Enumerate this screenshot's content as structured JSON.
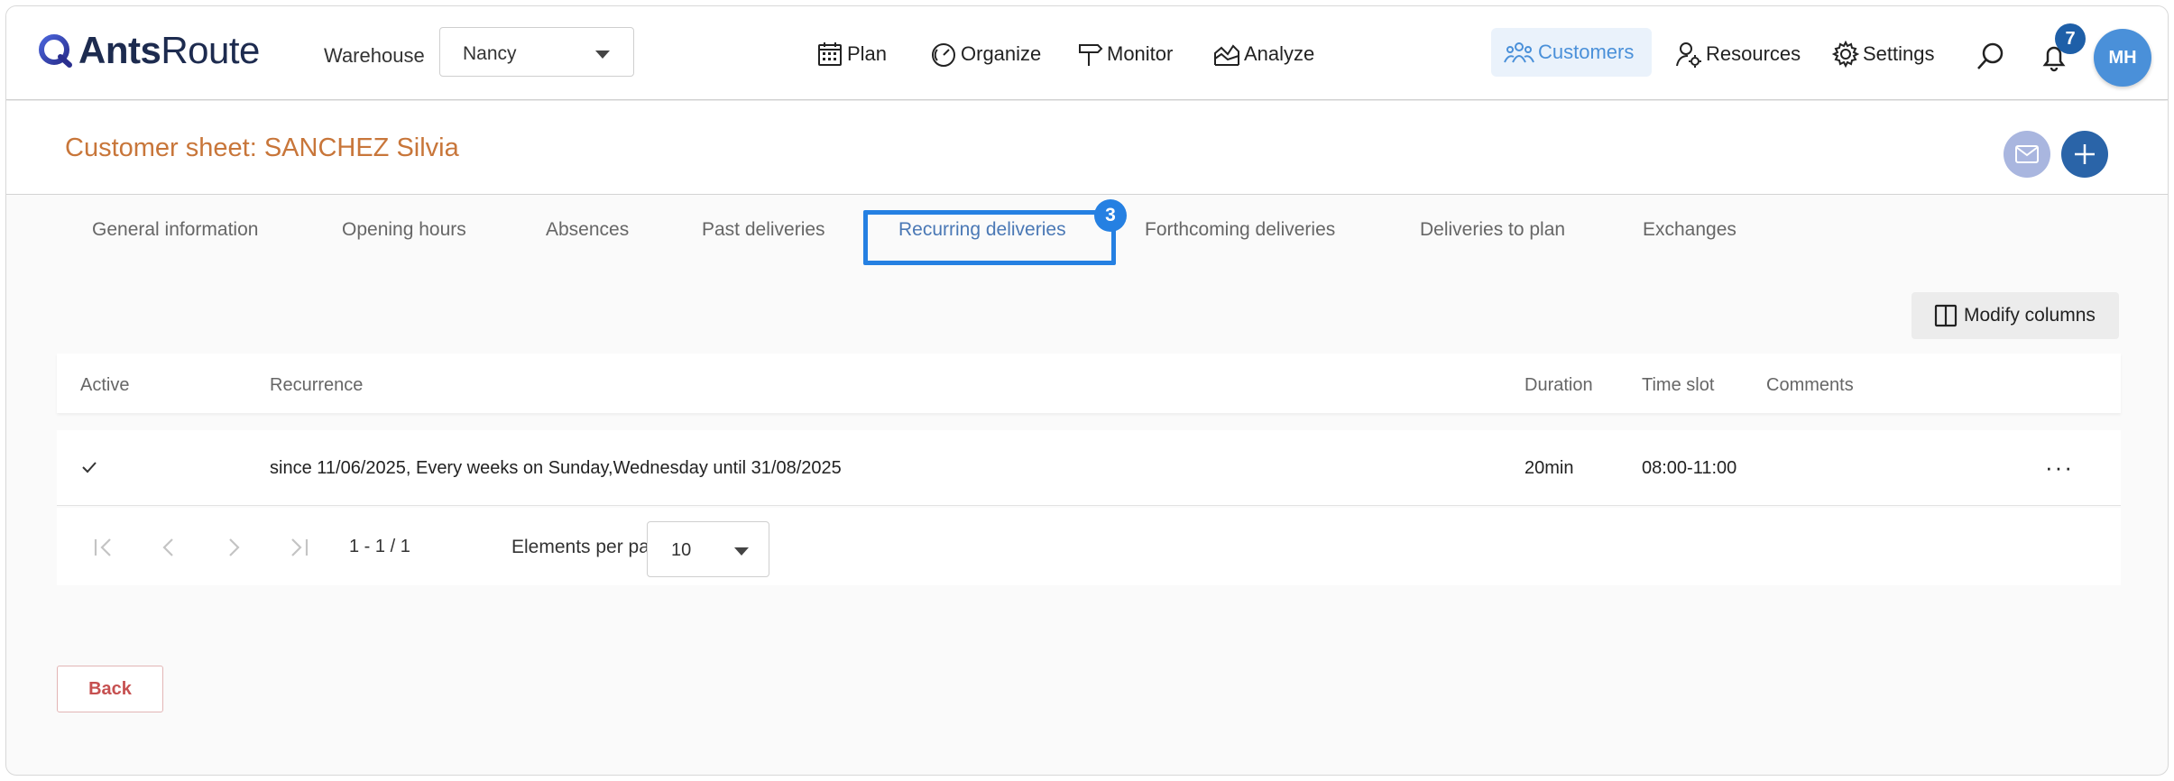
{
  "app": {
    "logo_bold": "Ants",
    "logo_light": "Route",
    "brand_color": "#1d2b4f",
    "accent_color": "#2580e2"
  },
  "topbar": {
    "warehouse_label": "Warehouse",
    "warehouse_value": "Nancy",
    "nav": {
      "plan": "Plan",
      "organize": "Organize",
      "monitor": "Monitor",
      "analyze": "Analyze",
      "customers": "Customers",
      "resources": "Resources",
      "settings": "Settings"
    },
    "notifications_count": "7",
    "avatar_initials": "MH"
  },
  "page": {
    "title": "Customer sheet: SANCHEZ Silvia"
  },
  "tabs": {
    "items": [
      "General information",
      "Opening hours",
      "Absences",
      "Past deliveries",
      "Recurring deliveries",
      "Forthcoming deliveries",
      "Deliveries to plan",
      "Exchanges"
    ],
    "active_index": 4,
    "active_badge": "3"
  },
  "toolbar": {
    "modify_columns": "Modify columns"
  },
  "table": {
    "columns": [
      "Active",
      "Recurrence",
      "Duration",
      "Time slot",
      "Comments"
    ],
    "rows": [
      {
        "active": true,
        "recurrence": "since 11/06/2025, Every weeks on Sunday,Wednesday until 31/08/2025",
        "duration": "20min",
        "time_slot": "08:00-11:00",
        "comments": ""
      }
    ]
  },
  "pagination": {
    "range": "1 - 1 / 1",
    "per_page_label": "Elements per page",
    "per_page_value": "10"
  },
  "footer": {
    "back_label": "Back"
  }
}
